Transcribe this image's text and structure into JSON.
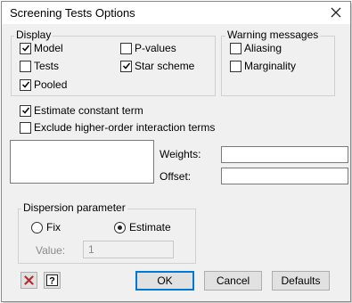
{
  "window": {
    "title": "Screening Tests Options",
    "close_icon": "close-icon"
  },
  "display": {
    "label": "Display",
    "model": {
      "label": "Model",
      "checked": true
    },
    "tests": {
      "label": "Tests",
      "checked": false
    },
    "pooled": {
      "label": "Pooled",
      "checked": true
    },
    "pvalues": {
      "label": "P-values",
      "checked": false
    },
    "star_scheme": {
      "label": "Star scheme",
      "checked": true
    }
  },
  "warning": {
    "label": "Warning messages",
    "aliasing": {
      "label": "Aliasing",
      "checked": false
    },
    "marginality": {
      "label": "Marginality",
      "checked": false
    }
  },
  "options": {
    "estimate_constant": {
      "label": "Estimate constant term",
      "checked": true
    },
    "exclude_higher": {
      "label": "Exclude higher-order interaction terms",
      "checked": false
    }
  },
  "weights": {
    "label": "Weights:",
    "value": ""
  },
  "offset": {
    "label": "Offset:",
    "value": ""
  },
  "dispersion": {
    "label": "Dispersion parameter",
    "fix_label": "Fix",
    "estimate_label": "Estimate",
    "selected": "Estimate",
    "value_label": "Value:",
    "value": "1"
  },
  "buttons": {
    "clear_icon": "red-x-icon",
    "help_icon": "help-icon",
    "ok": "OK",
    "cancel": "Cancel",
    "defaults": "Defaults"
  },
  "colors": {
    "accent": "#0078d7",
    "clear_icon": "#c0272d"
  }
}
